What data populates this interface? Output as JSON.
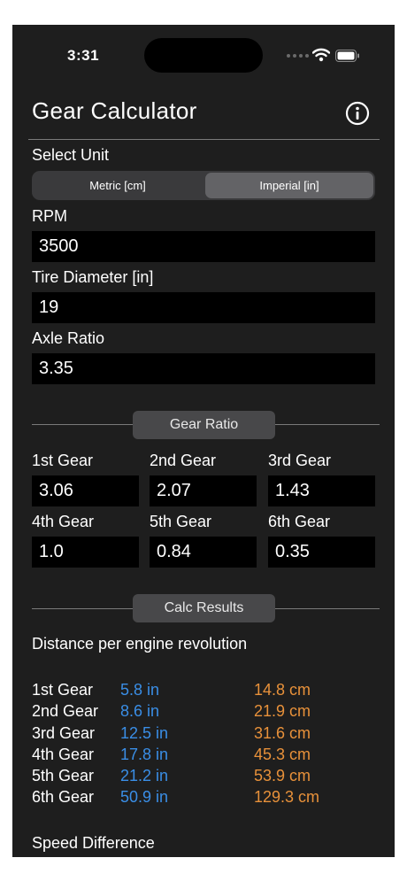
{
  "status_bar": {
    "time": "3:31"
  },
  "header": {
    "title": "Gear Calculator",
    "info_icon": "info-circle-icon"
  },
  "unit": {
    "label": "Select Unit",
    "options": [
      "Metric [cm]",
      "Imperial [in]"
    ],
    "selected": "Imperial [in]"
  },
  "inputs": {
    "rpm": {
      "label": "RPM",
      "value": "3500"
    },
    "tire": {
      "label": "Tire Diameter [in]",
      "value": "19"
    },
    "axle": {
      "label": "Axle Ratio",
      "value": "3.35"
    }
  },
  "gear_ratio": {
    "button": "Gear Ratio",
    "gears": [
      {
        "label": "1st Gear",
        "value": "3.06"
      },
      {
        "label": "2nd Gear",
        "value": "2.07"
      },
      {
        "label": "3rd Gear",
        "value": "1.43"
      },
      {
        "label": "4th Gear",
        "value": "1.0"
      },
      {
        "label": "5th Gear",
        "value": "0.84"
      },
      {
        "label": "6th Gear",
        "value": "0.35"
      }
    ]
  },
  "results": {
    "button": "Calc Results",
    "distance_label": "Distance per engine revolution",
    "rows": [
      {
        "gear": "1st Gear",
        "in": "5.8 in",
        "cm": "14.8 cm"
      },
      {
        "gear": "2nd Gear",
        "in": "8.6 in",
        "cm": "21.9 cm"
      },
      {
        "gear": "3rd Gear",
        "in": "12.5 in",
        "cm": "31.6 cm"
      },
      {
        "gear": "4th Gear",
        "in": "17.8 in",
        "cm": "45.3 cm"
      },
      {
        "gear": "5th Gear",
        "in": "21.2 in",
        "cm": "53.9 cm"
      },
      {
        "gear": "6th Gear",
        "in": "50.9 in",
        "cm": "129.3 cm"
      }
    ],
    "speed_label": "Speed Difference"
  },
  "colors": {
    "background": "#1e1e1e",
    "inch": "#3a8ee6",
    "cm": "#e8913a"
  }
}
